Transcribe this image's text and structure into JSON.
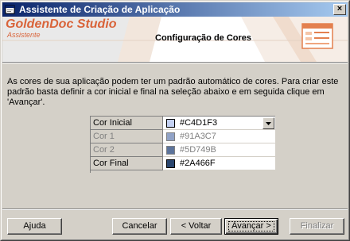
{
  "window": {
    "title": "Assistente de Criação de Aplicação",
    "close_symbol": "×"
  },
  "header": {
    "logo_text": "GoldenDoc Studio",
    "logo_subtitle": "Assistente",
    "title": "Configuração de Cores"
  },
  "description": "As cores de sua aplicação podem ter um padrão automático de cores. Para criar este padrão basta definir a cor inicial e final na seleção abaixo e em seguida clique em 'Avançar'.",
  "colors": {
    "rows": [
      {
        "label": "Cor Inicial",
        "value": "#C4D1F3",
        "swatch": "#c4d1f3"
      },
      {
        "label": "Cor 1",
        "value": "#91A3C7",
        "swatch": "#91a3c7"
      },
      {
        "label": "Cor 2",
        "value": "#5D749B",
        "swatch": "#5d749b"
      },
      {
        "label": "Cor Final",
        "value": "#2A466F",
        "swatch": "#2a466f"
      }
    ]
  },
  "buttons": {
    "help": "Ajuda",
    "cancel": "Cancelar",
    "back": "< Voltar",
    "next": "Avançar >",
    "finish": "Finalizar"
  }
}
